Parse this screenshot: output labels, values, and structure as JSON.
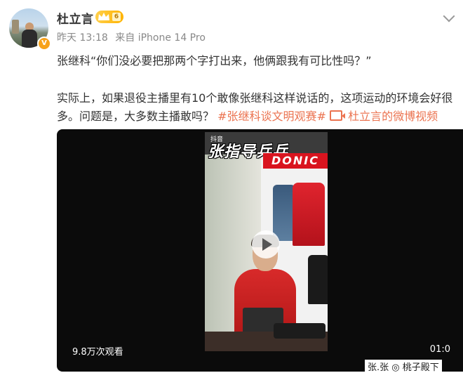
{
  "post": {
    "author": "杜立言",
    "vip_level": "6",
    "time": "昨天 13:18",
    "source": "来自 iPhone 14 Pro",
    "line1": "张继科“你们没必要把那两个字打出来，他俩跟我有可比性吗？”",
    "line2": "实际上，如果退役主播里有10个敢像张继科这样说话的，这项运动的环境会好很",
    "line3_text": "多。问题是，大多数主播敢吗？",
    "hashtag": "#张继科谈文明观赛#",
    "video_link": "杜立言的微博视频"
  },
  "video": {
    "overlay_title": "张指导乒乓",
    "tiktok_label": "抖音",
    "brand_sign": "DONIC",
    "views": "9.8万次观看",
    "duration": "01:0",
    "subtitle_peek": "张.张 ◎ 桃子殿下"
  },
  "colors": {
    "link": "#eb7350",
    "vip": "#ffb300",
    "verified": "#f7a21b"
  },
  "icons": [
    "vip-crown-icon",
    "verified-icon",
    "chevron-down-icon",
    "video-camera-icon",
    "play-icon"
  ]
}
